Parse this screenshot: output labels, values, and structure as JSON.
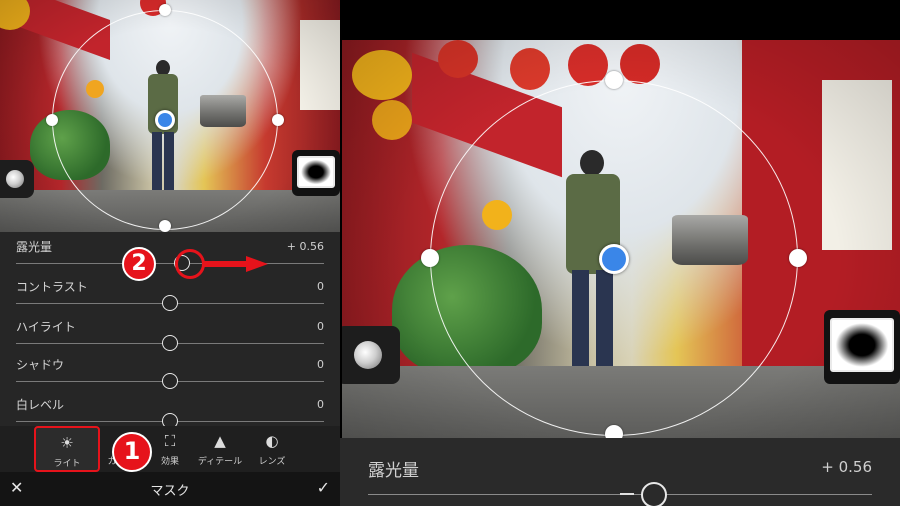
{
  "left_phone": {
    "sliders": [
      {
        "label": "露光量",
        "value": "+ 0.56",
        "position": 0.54
      },
      {
        "label": "コントラスト",
        "value": "0",
        "position": 0.5
      },
      {
        "label": "ハイライト",
        "value": "0",
        "position": 0.5
      },
      {
        "label": "シャドウ",
        "value": "0",
        "position": 0.5
      },
      {
        "label": "白レベル",
        "value": "0",
        "position": 0.5
      }
    ],
    "tools": [
      {
        "label": "ライト",
        "icon": "sun-icon",
        "active": true
      },
      {
        "label": "カ",
        "icon": "color-icon",
        "active": false
      },
      {
        "label": "効果",
        "icon": "effects-icon",
        "active": false
      },
      {
        "label": "ディテール",
        "icon": "detail-icon",
        "active": false
      },
      {
        "label": "レンズ",
        "icon": "lens-icon",
        "active": false
      }
    ],
    "bottom_bar": {
      "cancel": "✕",
      "title": "マスク",
      "confirm": "✓"
    },
    "annotations": {
      "step1": "1",
      "step2": "2"
    }
  },
  "right_view": {
    "slider": {
      "label": "露光量",
      "value": "+ 0.56"
    }
  },
  "colors": {
    "accent": "#e6131b",
    "mask_center": "#3a86e8"
  }
}
